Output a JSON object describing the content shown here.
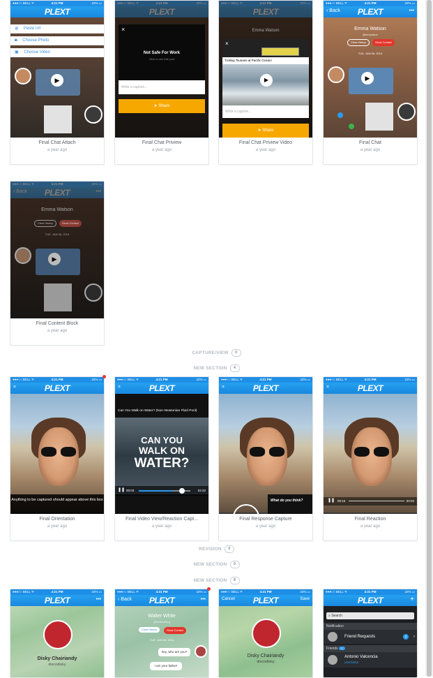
{
  "status_bar": {
    "carrier": "●●●○○ BELL ᯤ",
    "time": "4:21 PM",
    "battery": "22% ▭"
  },
  "app_logo": "PLEXT",
  "cards_row1": [
    {
      "title": "Final Chat Attach",
      "age": "a year ago"
    },
    {
      "title": "Final Chat Priview",
      "age": "a year ago"
    },
    {
      "title": "Final Chat Priview Video",
      "age": "a year ago"
    },
    {
      "title": "Final Chat",
      "age": "a year ago"
    }
  ],
  "cards_row2": [
    {
      "title": "Final Content Block",
      "age": "a year ago"
    }
  ],
  "cards_row3": [
    {
      "title": "Final Orientation",
      "age": "a year ago"
    },
    {
      "title": "Final Video View/Reaction Capt...",
      "age": "a year ago"
    },
    {
      "title": "Final Response Capture",
      "age": "a year ago"
    },
    {
      "title": "Final Reaction",
      "age": "a year ago"
    }
  ],
  "sections": [
    {
      "label": "CAPTURE/VIEW",
      "count": "0"
    },
    {
      "label": "NEW SECTION",
      "count": "4"
    },
    {
      "label": "REVISION",
      "count": "0"
    },
    {
      "label": "NEW SECTION",
      "count": "0"
    },
    {
      "label": "NEW SECTION",
      "count": "8"
    }
  ],
  "attach_menu": [
    "Paste Url",
    "Choose Photo",
    "Choose Video"
  ],
  "nsfw": {
    "title": "Not Safe For Work",
    "sub": "Click to see this post",
    "caption": "Write a caption...",
    "share": "Share"
  },
  "video_preview": {
    "contact": "Emma Watson",
    "title": "Trolling Tsunami at Pacific Ocean!",
    "caption": "Write a caption...",
    "share": "Share"
  },
  "chat": {
    "back": "Back",
    "name": "Emma Watson",
    "handle": "@emwatson",
    "clear": "Clear History",
    "block": "Block Contact",
    "date": "TUE, JAN 06, 2014"
  },
  "orientation_text": "Anything to be captured should appear above this box",
  "video_view": {
    "title": "Can You Walk on Water? (Non-Newtonian Fluid Pool)",
    "headline1": "CAN YOU",
    "headline2": "WALK ON",
    "headline3": "WATER?",
    "t_start": "00:03",
    "t_end": "02:32"
  },
  "response": {
    "question": "What do you think?"
  },
  "reaction": {
    "t": "00:15",
    "t_end": "00:03"
  },
  "row4": {
    "profile_name": "Disky Chairiandy",
    "profile_handle": "discodisky",
    "walter": "Walter White",
    "walter_handle": "@heisenberg",
    "walter_date": "TUE, JAN 06, 2014",
    "msg1": "hey, who are you?",
    "msg2": "I am your father!",
    "cancel": "Cancel",
    "save": "Save",
    "search": "Search",
    "notification": "Notification",
    "friend_requests": "Friend Requests",
    "friend_requests_count": "3",
    "friends": "Friends",
    "friends_count": "12",
    "friend1": "Antonio Valcencia",
    "friend1_handle": "username"
  }
}
